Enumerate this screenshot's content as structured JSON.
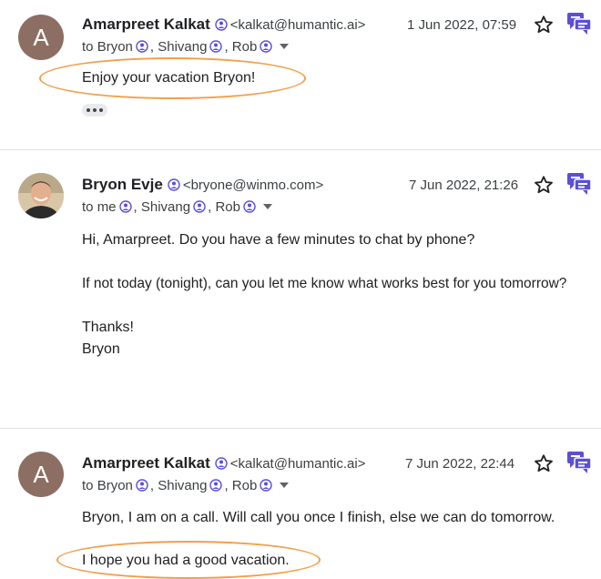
{
  "messages": [
    {
      "avatar_initial": "A",
      "sender_name": "Amarpreet Kalkat",
      "sender_email": "<kalkat@humantic.ai>",
      "date": "1 Jun 2022, 07:59",
      "to_prefix": "to",
      "recipients": [
        "Bryon",
        "Shivang",
        "Rob"
      ],
      "body": [
        "Enjoy your vacation Bryon!"
      ]
    },
    {
      "avatar_initial": "",
      "sender_name": "Bryon Evje",
      "sender_email": "<bryone@winmo.com>",
      "date": "7 Jun 2022, 21:26",
      "to_prefix": "to",
      "recipients": [
        "me",
        "Shivang",
        "Rob"
      ],
      "body": [
        "Hi, Amarpreet. Do you have a few minutes to chat by phone?",
        "If not today (tonight), can you let me know what works best for you tomorrow?",
        "Thanks!",
        "Bryon"
      ]
    },
    {
      "avatar_initial": "A",
      "sender_name": "Amarpreet Kalkat",
      "sender_email": "<kalkat@humantic.ai>",
      "date": "7 Jun 2022, 22:44",
      "to_prefix": "to",
      "recipients": [
        "Bryon",
        "Shivang",
        "Rob"
      ],
      "body": [
        "Bryon, I am on a call. Will call you once I finish, else we can do tomorrow.",
        "I hope you had a good vacation."
      ]
    }
  ],
  "colors": {
    "highlight_ellipse": "#f0a04b",
    "avatar_bg": "#8d6e63",
    "chat_icon": "#5b4fd6"
  },
  "icons": {
    "star": "star-icon",
    "chat": "chat-icon",
    "person": "person-icon",
    "caret": "chevron-down-icon"
  }
}
